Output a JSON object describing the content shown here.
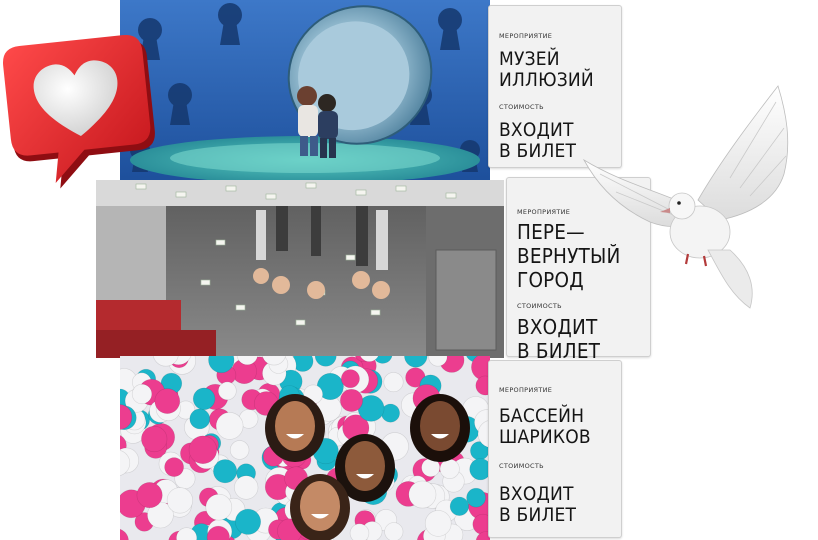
{
  "cards": [
    {
      "event_label": "Мероприятие",
      "event_title": "МУЗЕЙ\nИЛЛЮЗИЙ",
      "price_label": "Стоимость",
      "price_value": "ВХОДИТ\nВ БИЛЕТ"
    },
    {
      "event_label": "Мероприятие",
      "event_title": "ПЕРЕ—\nВЕРНУТЫЙ\nГОРОД",
      "price_label": "Стоимость",
      "price_value": "ВХОДИТ\nВ БИЛЕТ"
    },
    {
      "event_label": "Мероприятие",
      "event_title": "БАССЕЙН\nШАРИКОВ",
      "price_label": "Стоимость",
      "price_value": "ВХОДИТ\nВ БИЛЕТ"
    }
  ],
  "decor": {
    "like_badge_icon": "heart-like-icon",
    "bird_icon": "white-dove-icon"
  },
  "colors": {
    "card_bg": "#f2f2f2",
    "museum_blue": "#2f66b6",
    "like_red": "#e0262b",
    "ball_pink": "#ec3d8f",
    "ball_cyan": "#1ab5c9"
  }
}
